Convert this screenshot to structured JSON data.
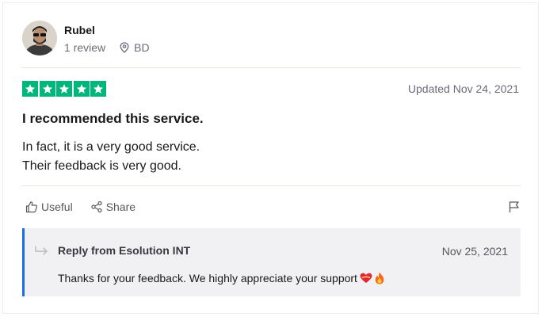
{
  "reviewer": {
    "name": "Rubel",
    "review_count": "1 review",
    "country": "BD"
  },
  "rating": {
    "stars": 5,
    "max_stars": 5,
    "star_color": "#00b67a"
  },
  "review": {
    "updated": "Updated Nov 24, 2021",
    "title": "I recommended this service.",
    "body_line1": "In fact, it is a very good service.",
    "body_line2": "Their feedback is very good."
  },
  "actions": {
    "useful_label": "Useful",
    "share_label": "Share"
  },
  "reply": {
    "from": "Reply from Esolution INT",
    "date": "Nov 25, 2021",
    "text": "Thanks for your feedback. We highly appreciate your support",
    "accent_color": "#1c6fdd"
  },
  "icons": [
    "location-pin-icon",
    "thumbs-up-icon",
    "share-icon",
    "flag-icon",
    "reply-arrow-icon",
    "heart-emoji-icon",
    "fire-emoji-icon"
  ]
}
